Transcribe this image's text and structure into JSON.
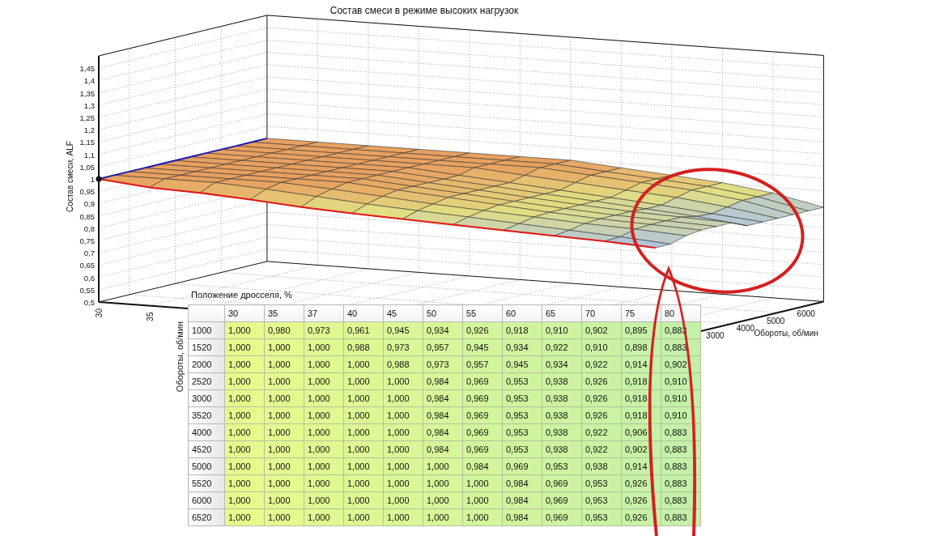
{
  "chart": {
    "title": "Состав смеси в режиме высоких нагрузок",
    "z_label": "Состав смеси, ALF",
    "z_ticks": [
      "1,45",
      "1,4",
      "1,35",
      "1,3",
      "1,25",
      "1,2",
      "1,15",
      "1,1",
      "1,05",
      "1",
      "0,95",
      "0,9",
      "0,85",
      "0,8",
      "0,75",
      "0,7",
      "0,65",
      "0,6",
      "0,55",
      "0,5"
    ],
    "throttle_ticks": [
      "30",
      "35"
    ],
    "rpm_label": "Обороты, об/мин",
    "rpm_ticks": [
      "3000",
      "4000",
      "5000",
      "6000"
    ]
  },
  "table": {
    "caption": "Положение дросселя, %",
    "row_axis_label": "Обороты, об/мин",
    "columns": [
      "30",
      "35",
      "37",
      "40",
      "45",
      "50",
      "55",
      "60",
      "65",
      "70",
      "75",
      "80"
    ],
    "rows": [
      {
        "rpm": "1000",
        "values": [
          "1,000",
          "0,980",
          "0,973",
          "0,961",
          "0,945",
          "0,934",
          "0,926",
          "0,918",
          "0,910",
          "0,902",
          "0,895",
          "0,883"
        ]
      },
      {
        "rpm": "1520",
        "values": [
          "1,000",
          "1,000",
          "1,000",
          "0,988",
          "0,973",
          "0,957",
          "0,945",
          "0,934",
          "0,922",
          "0,910",
          "0,898",
          "0,883"
        ]
      },
      {
        "rpm": "2000",
        "values": [
          "1,000",
          "1,000",
          "1,000",
          "1,000",
          "0,988",
          "0,973",
          "0,957",
          "0,945",
          "0,934",
          "0,922",
          "0,914",
          "0,902"
        ]
      },
      {
        "rpm": "2520",
        "values": [
          "1,000",
          "1,000",
          "1,000",
          "1,000",
          "1,000",
          "0,984",
          "0,969",
          "0,953",
          "0,938",
          "0,926",
          "0,918",
          "0,910"
        ]
      },
      {
        "rpm": "3000",
        "values": [
          "1,000",
          "1,000",
          "1,000",
          "1,000",
          "1,000",
          "0,984",
          "0,969",
          "0,953",
          "0,938",
          "0,926",
          "0,918",
          "0,910"
        ]
      },
      {
        "rpm": "3520",
        "values": [
          "1,000",
          "1,000",
          "1,000",
          "1,000",
          "1,000",
          "0,984",
          "0,969",
          "0,953",
          "0,938",
          "0,926",
          "0,918",
          "0,910"
        ]
      },
      {
        "rpm": "4000",
        "values": [
          "1,000",
          "1,000",
          "1,000",
          "1,000",
          "1,000",
          "0,984",
          "0,969",
          "0,953",
          "0,938",
          "0,922",
          "0,906",
          "0,883"
        ]
      },
      {
        "rpm": "4520",
        "values": [
          "1,000",
          "1,000",
          "1,000",
          "1,000",
          "1,000",
          "0,984",
          "0,969",
          "0,953",
          "0,938",
          "0,922",
          "0,902",
          "0,883"
        ]
      },
      {
        "rpm": "5000",
        "values": [
          "1,000",
          "1,000",
          "1,000",
          "1,000",
          "1,000",
          "1,000",
          "0,984",
          "0,969",
          "0,953",
          "0,938",
          "0,914",
          "0,883"
        ]
      },
      {
        "rpm": "5520",
        "values": [
          "1,000",
          "1,000",
          "1,000",
          "1,000",
          "1,000",
          "1,000",
          "1,000",
          "0,984",
          "0,969",
          "0,953",
          "0,926",
          "0,883"
        ]
      },
      {
        "rpm": "6000",
        "values": [
          "1,000",
          "1,000",
          "1,000",
          "1,000",
          "1,000",
          "1,000",
          "1,000",
          "0,984",
          "0,969",
          "0,953",
          "0,926",
          "0,883"
        ]
      },
      {
        "rpm": "6520",
        "values": [
          "1,000",
          "1,000",
          "1,000",
          "1,000",
          "1,000",
          "1,000",
          "1,000",
          "0,984",
          "0,969",
          "0,953",
          "0,926",
          "0,883"
        ]
      }
    ]
  }
}
